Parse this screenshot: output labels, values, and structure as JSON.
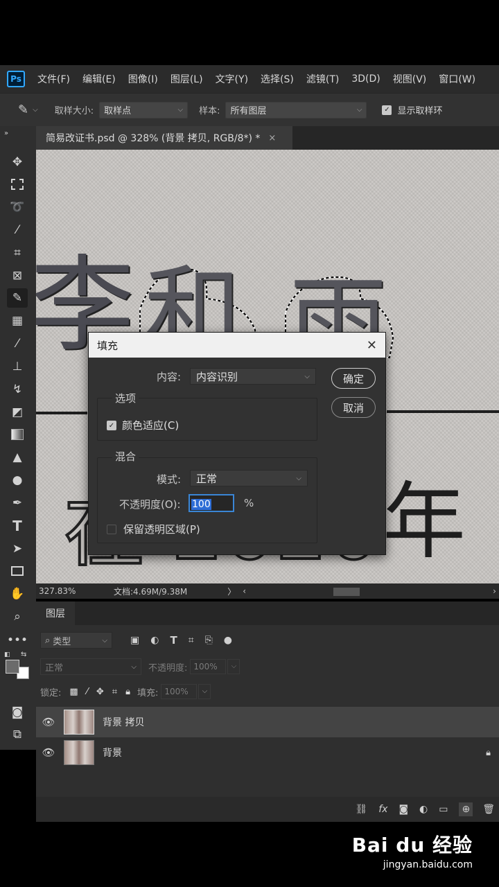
{
  "menubar": {
    "logo": "Ps",
    "items": [
      "文件(F)",
      "编辑(E)",
      "图像(I)",
      "图层(L)",
      "文字(Y)",
      "选择(S)",
      "滤镜(T)",
      "3D(D)",
      "视图(V)",
      "窗口(W)"
    ]
  },
  "options": {
    "sample_size_label": "取样大小:",
    "sample_size_value": "取样点",
    "sample_label": "样本:",
    "sample_value": "所有图层",
    "show_ring_label": "显示取样环",
    "show_ring_checked": true
  },
  "document_tab": {
    "title": "简易改证书.psd @ 328% (背景 拷贝, RGB/8*) *",
    "close": "×"
  },
  "canvas": {
    "text_fragments": [
      "李",
      "和",
      "雨",
      "在 2020",
      "年"
    ]
  },
  "status": {
    "zoom": "327.83%",
    "doc_info": "文档:4.69M/9.38M"
  },
  "dialog": {
    "title": "填充",
    "content_label": "内容:",
    "content_value": "内容识别",
    "options_group": "选项",
    "color_adapt_label": "颜色适应(C)",
    "color_adapt_checked": true,
    "blend_group": "混合",
    "mode_label": "模式:",
    "mode_value": "正常",
    "opacity_label": "不透明度(O):",
    "opacity_value": "100",
    "opacity_unit": "%",
    "preserve_label": "保留透明区域(P)",
    "preserve_checked": false,
    "ok_label": "确定",
    "cancel_label": "取消"
  },
  "layers_panel": {
    "tab_label": "图层",
    "filter_kind": "类型",
    "blend_mode": "正常",
    "opacity_label": "不透明度:",
    "opacity_value": "100%",
    "lock_label": "锁定:",
    "fill_label": "填充:",
    "fill_value": "100%",
    "layers": [
      {
        "name": "背景 拷贝",
        "selected": true,
        "locked": false
      },
      {
        "name": "背景",
        "selected": false,
        "locked": true
      }
    ]
  },
  "watermark": {
    "brand": "Bai du 经验",
    "url": "jingyan.baidu.com"
  },
  "colors": {
    "accent": "#31a8ff",
    "panel": "#323232",
    "dark": "#262626"
  }
}
